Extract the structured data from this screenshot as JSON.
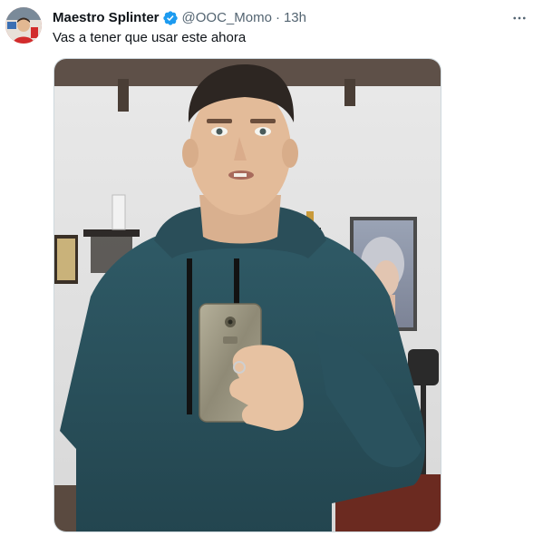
{
  "author": {
    "display_name": "Maestro Splinter",
    "handle": "@OOC_Momo",
    "verified": true,
    "avatar_icon": "profile-avatar"
  },
  "post": {
    "separator": "·",
    "timestamp": "13h",
    "text": "Vas a tener que usar este ahora"
  },
  "icons": {
    "verified": "verified-badge-icon",
    "more": "more-options-icon"
  },
  "colors": {
    "verified_blue": "#1d9bf0",
    "secondary_text": "#536471",
    "primary_text": "#0f1419"
  }
}
